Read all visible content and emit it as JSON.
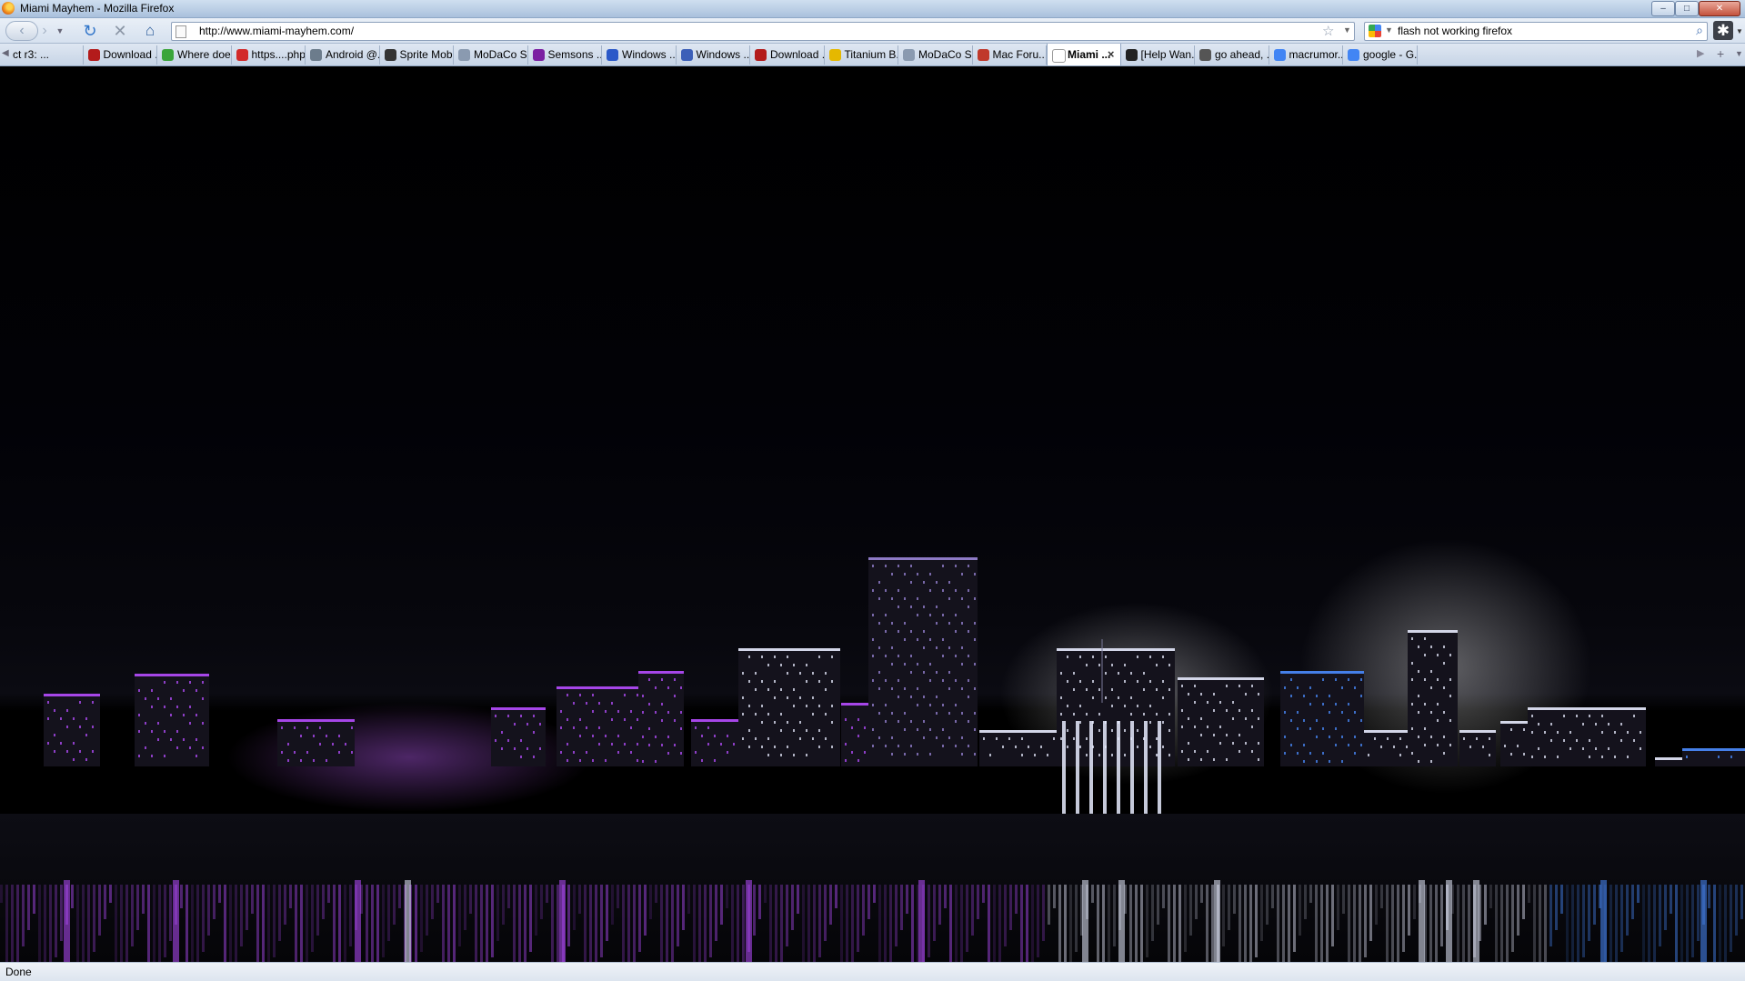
{
  "window": {
    "title": "Miami Mayhem - Mozilla Firefox",
    "minimize_glyph": "–",
    "maximize_glyph": "□",
    "close_glyph": "✕"
  },
  "toolbar": {
    "url": "http://www.miami-mayhem.com/",
    "search_query": "flash not working firefox",
    "back_glyph": "‹",
    "forward_glyph": "›",
    "reload_glyph": "↻",
    "stop_glyph": "✕",
    "home_glyph": "⌂"
  },
  "tabs": [
    {
      "label": "ct r3: ...",
      "icon": "none",
      "color": ""
    },
    {
      "label": "Download ...",
      "icon": "red-badge-icon",
      "color": "#b31b1b"
    },
    {
      "label": "Where doe...",
      "icon": "green-star-icon",
      "color": "#3aa53a"
    },
    {
      "label": "https....php",
      "icon": "red-square-icon",
      "color": "#d22a2a"
    },
    {
      "label": "Android @...",
      "icon": "globe-icon",
      "color": "#6c7c8c"
    },
    {
      "label": "Sprite Mob...",
      "icon": "phone-icon",
      "color": "#333333"
    },
    {
      "label": "MoDaCo S...",
      "icon": "modaco-icon",
      "color": "#8a9ab0"
    },
    {
      "label": "Semsons ...",
      "icon": "yahoo-icon",
      "color": "#7b1fa2"
    },
    {
      "label": "Windows ...",
      "icon": "lock-icon",
      "color": "#2a58c8"
    },
    {
      "label": "Windows ...",
      "icon": "windows-flag-icon",
      "color": "#3b5fb8"
    },
    {
      "label": "Download ...",
      "icon": "red-badge-icon",
      "color": "#b31b1b"
    },
    {
      "label": "Titanium B...",
      "icon": "smiley-icon",
      "color": "#e5b800"
    },
    {
      "label": "MoDaCo S...",
      "icon": "modaco-icon",
      "color": "#8a9ab0"
    },
    {
      "label": "Mac Foru...",
      "icon": "apple-icon",
      "color": "#c0392b"
    },
    {
      "label": "Miami ...",
      "icon": "page-icon",
      "color": "#ffffff",
      "active": true
    },
    {
      "label": "[Help Wan...",
      "icon": "diamond-icon",
      "color": "#222222"
    },
    {
      "label": "go ahead, ...",
      "icon": "tn-icon",
      "color": "#555555"
    },
    {
      "label": "macrumor...",
      "icon": "google-icon",
      "color": "#4285f4"
    },
    {
      "label": "google - G...",
      "icon": "google-icon",
      "color": "#4285f4"
    }
  ],
  "colors": {
    "skyline_purple": "#b64dff",
    "skyline_white": "#e8ecff",
    "skyline_blue": "#4a8cff"
  },
  "status": {
    "text": "Done"
  }
}
